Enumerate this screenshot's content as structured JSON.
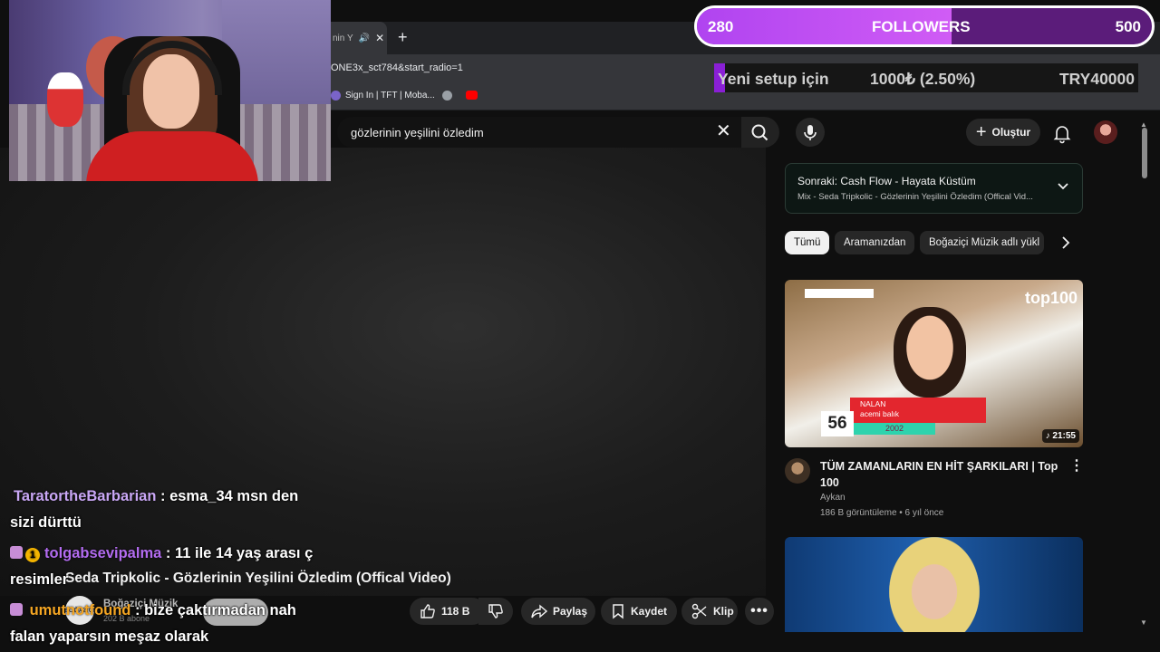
{
  "browser": {
    "tab_title": "nin Y",
    "new_tab": "+",
    "url": "ONE3x_sct784&start_radio=1",
    "bookmarks": [
      {
        "label": "Sign In | TFT | Moba..."
      }
    ]
  },
  "youtube": {
    "search_query": "gözlerinin yeşilini özledim",
    "create_label": "Oluştur",
    "up_next": {
      "title": "Sonraki: Cash Flow - Hayata Küstüm",
      "subtitle": "Mix - Seda Tripkolic - Gözlerinin Yeşilini Özledim (Offical Vid..."
    },
    "chips": [
      "Tümü",
      "Aramanızdan",
      "Boğaziçi Müzik adlı yükl"
    ],
    "recommended": [
      {
        "title": "TÜM ZAMANLARIN EN HİT ŞARKILARI | Top 100",
        "channel": "Aykan",
        "meta": "186 B görüntüleme • 6 yıl önce",
        "duration": "21:55",
        "overlay_brand": "top100",
        "overlay_rank": "56",
        "overlay_artist": "NALAN",
        "overlay_song": "acemi balık",
        "overlay_year": "2002"
      }
    ],
    "video": {
      "title": "Seda Tripkolic - Gözlerinin Yeşilini Özledim (Offical Video)",
      "channel": "Boğaziçi Müzik",
      "subscribers": "202 B abone",
      "channel_logo": "BOĞAZİÇİ",
      "likes": "118 B",
      "share_label": "Paylaş",
      "save_label": "Kaydet",
      "clip_label": "Klip"
    }
  },
  "stream_overlay": {
    "followers": {
      "current": "280",
      "label": "FOLLOWERS",
      "goal": "500",
      "progress": 0.56
    },
    "donation": {
      "label": "Yeni setup için",
      "amount": "1000₺ (2.50%)",
      "goal": "TRY40000",
      "progress": 0.025
    },
    "chat": [
      {
        "user": "TaratortheBarbarian",
        "color": "#c9a7f5",
        "message_line1": ": esma_34 msn den",
        "message_line2": "sizi dürttü"
      },
      {
        "user": "tolgabsevipalma",
        "color": "#b36cf0",
        "message_line1": ": 11 ile 14 yaş arası ç",
        "message_line2": "resimler"
      },
      {
        "user": "umutnotfound",
        "color": "#f5a623",
        "message_line1": ": bize çaktırmadan nah",
        "message_line2": "falan yaparsın meşaz olarak"
      }
    ]
  },
  "colors": {
    "bg": "#0f0f0f",
    "chip_active": "#f1f1f1",
    "followers_bar": "#b044f0",
    "donation_bar": "#8a1fd6"
  }
}
